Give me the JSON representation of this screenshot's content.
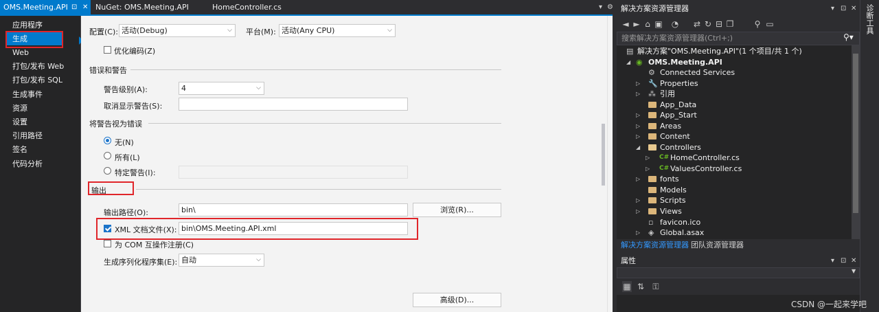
{
  "tabs": {
    "active": {
      "label": "OMS.Meeting.API",
      "pin": "⊡",
      "close": "✕"
    },
    "others": [
      "NuGet: OMS.Meeting.API",
      "HomeController.cs"
    ],
    "overflow": "▾",
    "settings": "⚙"
  },
  "nav": {
    "items": [
      "应用程序",
      "生成",
      "Web",
      "打包/发布 Web",
      "打包/发布 SQL",
      "生成事件",
      "资源",
      "设置",
      "引用路径",
      "签名",
      "代码分析"
    ],
    "selected": 1
  },
  "config": {
    "config_label": "配置(C):",
    "config_value": "活动(Debug)",
    "platform_label": "平台(M):",
    "platform_value": "活动(Any CPU)"
  },
  "build": {
    "optimize_label": "优化编码(Z)",
    "optimize_checked": false
  },
  "errors": {
    "title": "错误和警告",
    "level_label": "警告级别(A):",
    "level_value": "4",
    "suppress_label": "取消显示警告(S):",
    "suppress_value": ""
  },
  "treat": {
    "title": "将警告视为错误",
    "none_label": "无(N)",
    "all_label": "所有(L)",
    "specific_label": "特定警告(I):",
    "selected": "none"
  },
  "output": {
    "title": "输出",
    "path_label": "输出路径(O):",
    "path_value": "bin\\",
    "browse_label": "浏览(R)...",
    "xml_label": "XML 文档文件(X):",
    "xml_value": "bin\\OMS.Meeting.API.xml",
    "xml_checked": true,
    "com_label": "为 COM 互操作注册(C)",
    "com_checked": false,
    "serial_label": "生成序列化程序集(E):",
    "serial_value": "自动",
    "advanced_label": "高级(D)..."
  },
  "solution_explorer": {
    "title": "解决方案资源管理器",
    "search_placeholder": "搜索解决方案资源管理器(Ctrl+;)",
    "tree": [
      {
        "text": "解决方案\"OMS.Meeting.API\"(1 个项目/共 1 个)",
        "icon": "solution-icon",
        "level": 0,
        "expander": ""
      },
      {
        "text": "OMS.Meeting.API",
        "icon": "web-project-icon",
        "level": 1,
        "expander": "expanded",
        "bold": true
      },
      {
        "text": "Connected Services",
        "icon": "connected-services-icon",
        "level": 2,
        "expander": ""
      },
      {
        "text": "Properties",
        "icon": "wrench-icon",
        "level": 2,
        "expander": "collapsed"
      },
      {
        "text": "引用",
        "icon": "references-icon",
        "level": 2,
        "expander": "collapsed"
      },
      {
        "text": "App_Data",
        "icon": "folder-icon",
        "level": 2,
        "expander": ""
      },
      {
        "text": "App_Start",
        "icon": "folder-icon",
        "level": 2,
        "expander": "collapsed"
      },
      {
        "text": "Areas",
        "icon": "folder-icon",
        "level": 2,
        "expander": "collapsed"
      },
      {
        "text": "Content",
        "icon": "folder-icon",
        "level": 2,
        "expander": "collapsed"
      },
      {
        "text": "Controllers",
        "icon": "folder-open-icon",
        "level": 2,
        "expander": "expanded"
      },
      {
        "text": "HomeController.cs",
        "icon": "csharp-file-icon",
        "level": 3,
        "expander": "collapsed"
      },
      {
        "text": "ValuesController.cs",
        "icon": "csharp-file-icon",
        "level": 3,
        "expander": "collapsed"
      },
      {
        "text": "fonts",
        "icon": "folder-icon",
        "level": 2,
        "expander": "collapsed"
      },
      {
        "text": "Models",
        "icon": "folder-icon",
        "level": 2,
        "expander": ""
      },
      {
        "text": "Scripts",
        "icon": "folder-icon",
        "level": 2,
        "expander": "collapsed"
      },
      {
        "text": "Views",
        "icon": "folder-icon",
        "level": 2,
        "expander": "collapsed"
      },
      {
        "text": "favicon.ico",
        "icon": "image-file-icon",
        "level": 2,
        "expander": ""
      },
      {
        "text": "Global.asax",
        "icon": "asax-file-icon",
        "level": 2,
        "expander": "collapsed"
      }
    ],
    "bottom_tabs": [
      "解决方案资源管理器",
      "团队资源管理器"
    ]
  },
  "properties": {
    "title": "属性"
  },
  "right_strip": {
    "label": "诊断工具"
  },
  "watermark": "CSDN @一起来学吧",
  "colors": {
    "accent": "#007acc",
    "highlight_box": "#e0252a",
    "csharp_icon": "#68b723",
    "folder": "#dcb67a"
  }
}
